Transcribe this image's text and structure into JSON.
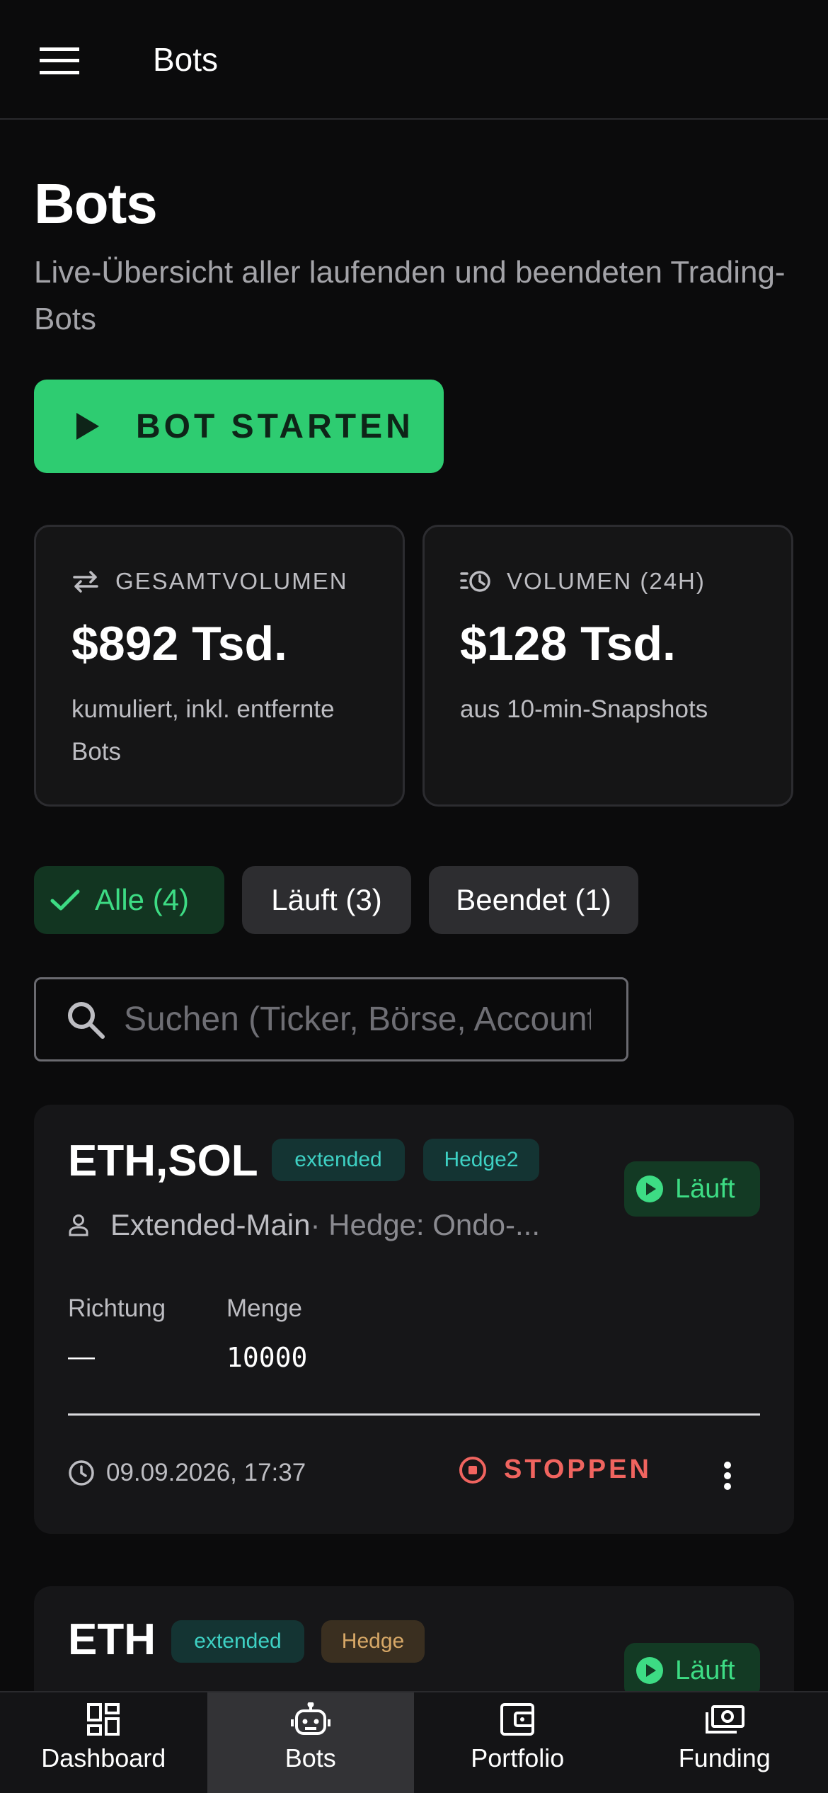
{
  "appbar": {
    "title": "Bots",
    "menu_icon": "hamburger-menu-icon"
  },
  "header": {
    "title": "Bots",
    "subtitle": "Live-Übersicht aller laufenden und beendeten Trading-Bots"
  },
  "start_button": {
    "label": "BOT STARTEN",
    "icon": "play-icon"
  },
  "stats": [
    {
      "label": "GESAMTVOLUMEN",
      "value": "$892 Tsd.",
      "note": "kumuliert, inkl. entfernte Bots",
      "icon": "swap-arrows-icon"
    },
    {
      "label": "VOLUMEN (24H)",
      "value": "$128 Tsd.",
      "note": "aus 10-min-Snapshots",
      "icon": "history-icon"
    }
  ],
  "filters": [
    {
      "label": "Alle (4)",
      "selected": true
    },
    {
      "label": "Läuft (3)",
      "selected": false
    },
    {
      "label": "Beendet (1)",
      "selected": false
    }
  ],
  "search": {
    "placeholder": "Suchen (Ticker, Börse, Account)",
    "value": ""
  },
  "bots": [
    {
      "ticker": "ETH,SOL",
      "tags": [
        "extended",
        "Hedge2"
      ],
      "status": "Läuft",
      "account": "Extended-Main",
      "hedge": " · Hedge: Ondo-...",
      "direction_label": "Richtung",
      "direction_value": "—",
      "quantity_label": "Menge",
      "quantity_value": "10000",
      "timestamp": "09.09.2026, 17:37",
      "stop_label": "STOPPEN"
    },
    {
      "ticker": "ETH",
      "tags": [
        "extended",
        "Hedge"
      ],
      "status": "Läuft"
    }
  ],
  "bottom_nav": [
    {
      "label": "Dashboard",
      "icon": "dashboard-icon",
      "active": false
    },
    {
      "label": "Bots",
      "icon": "robot-icon",
      "active": true
    },
    {
      "label": "Portfolio",
      "icon": "wallet-icon",
      "active": false
    },
    {
      "label": "Funding",
      "icon": "money-icon",
      "active": false
    }
  ],
  "colors": {
    "accent_green": "#2ecc71",
    "status_green": "#3ddc84",
    "stop_red": "#f0645f",
    "tag_teal": "#3ed1c4",
    "tag_amber": "#d7a867",
    "background": "#0b0b0c"
  }
}
